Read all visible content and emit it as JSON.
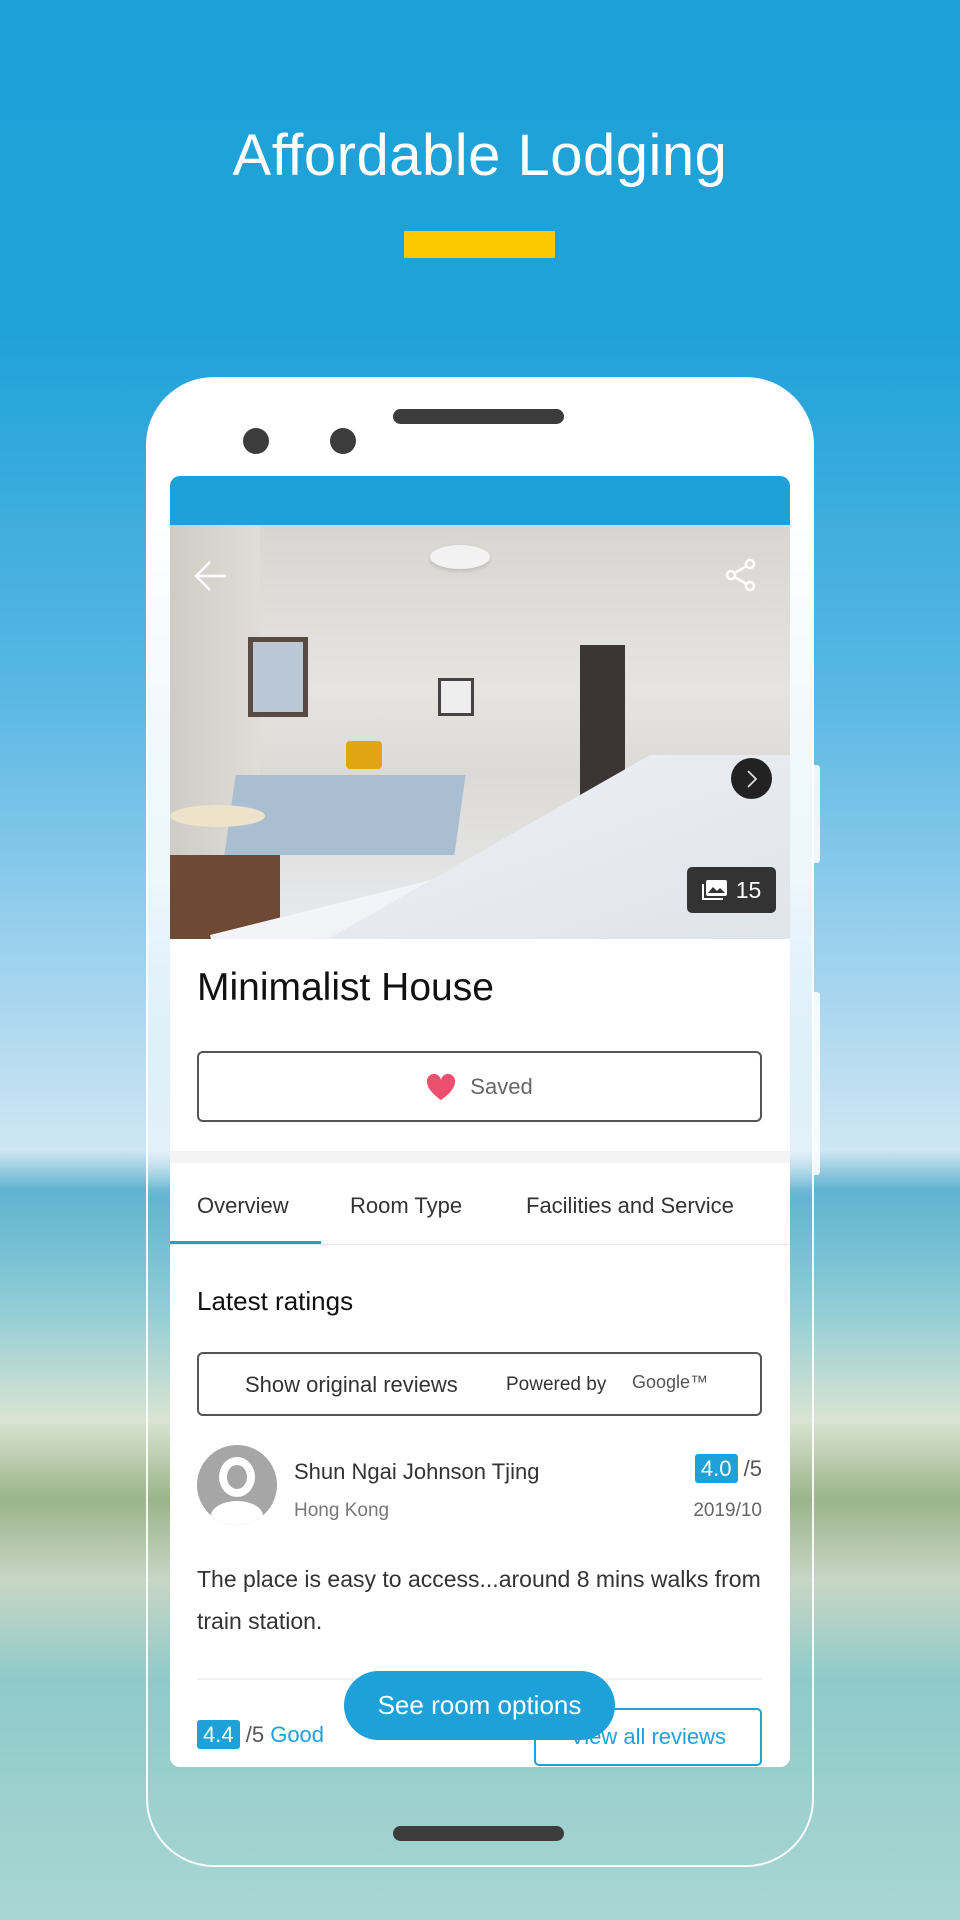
{
  "promo": {
    "headline": "Affordable Lodging",
    "accent_color": "#fdc800"
  },
  "app": {
    "brand_color": "#1ea1d8",
    "photo": {
      "count": "15",
      "back_icon": "arrow-left-icon",
      "share_icon": "share-icon",
      "next_icon": "chevron-right-icon",
      "gallery_icon": "image-icon"
    },
    "listing": {
      "name": "Minimalist House",
      "saved_label": "Saved"
    },
    "tabs": [
      {
        "label": "Overview",
        "active": true
      },
      {
        "label": "Room Type"
      },
      {
        "label": "Facilities and Service"
      }
    ],
    "ratings": {
      "heading": "Latest ratings",
      "show_original": "Show original reviews",
      "powered_by": "Powered by",
      "google": "Google™",
      "review": {
        "name": "Shun Ngai Johnson Tjing",
        "location": "Hong Kong",
        "score": "4.0",
        "out_of": "/5",
        "date": "2019/10",
        "text": "The place is easy to access...around 8 mins walks from train station."
      },
      "overall": {
        "score": "4.4",
        "out_of": "/5",
        "label": "Good"
      },
      "view_all": "View all reviews"
    },
    "cta": "See room options"
  }
}
